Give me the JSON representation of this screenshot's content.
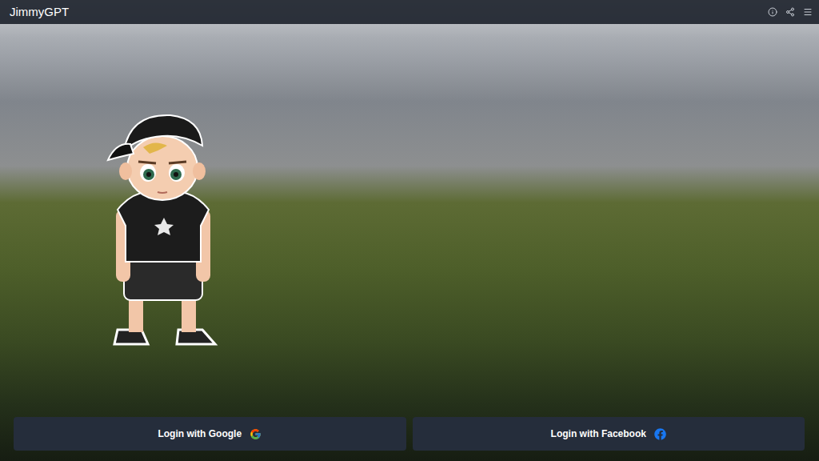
{
  "header": {
    "title": "JimmyGPT"
  },
  "buttons": [
    {
      "label": "Login with Google",
      "kind": "google"
    },
    {
      "label": "Login with Facebook",
      "kind": "facebook"
    }
  ]
}
